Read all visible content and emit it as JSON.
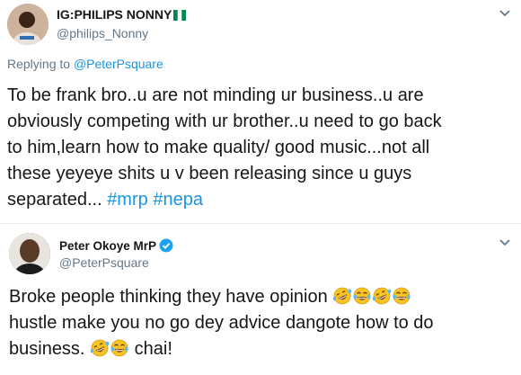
{
  "tweet1": {
    "display_name": "IG:PHILIPS NONNY",
    "handle": "@philips_Nonny",
    "replying_label": "Replying to",
    "replying_to": "@PeterPsquare",
    "text_line1": "To be frank bro..u are not minding ur business..u are",
    "text_line2": "obviously competing with ur brother..u need to go back",
    "text_line3": "to him,learn how to make quality/ good music...not all",
    "text_line4": "these yeyeye shits u v been releasing since u guys",
    "text_line5": "separated...",
    "hashtag1": "#mrp",
    "hashtag2": "#nepa",
    "icons": [
      "avatar",
      "nigeria-flag-icon",
      "chevron-down-icon"
    ]
  },
  "tweet2": {
    "display_name": "Peter Okoye MrP",
    "handle": "@PeterPsquare",
    "text_line1": "Broke people thinking they have opinion",
    "text_line2": "hustle make you no go dey advice dangote how to do",
    "text_line3": "business.",
    "text_line3_end": "chai!",
    "icons": [
      "avatar",
      "verified-icon",
      "chevron-down-icon",
      "rofl-emoji-icon",
      "joy-emoji-icon"
    ]
  },
  "colors": {
    "text": "#14171a",
    "secondary": "#657786",
    "link": "#1b95e0",
    "divider": "#e6ecf0",
    "verified": "#1da1f2",
    "flag_green": "#008751"
  }
}
